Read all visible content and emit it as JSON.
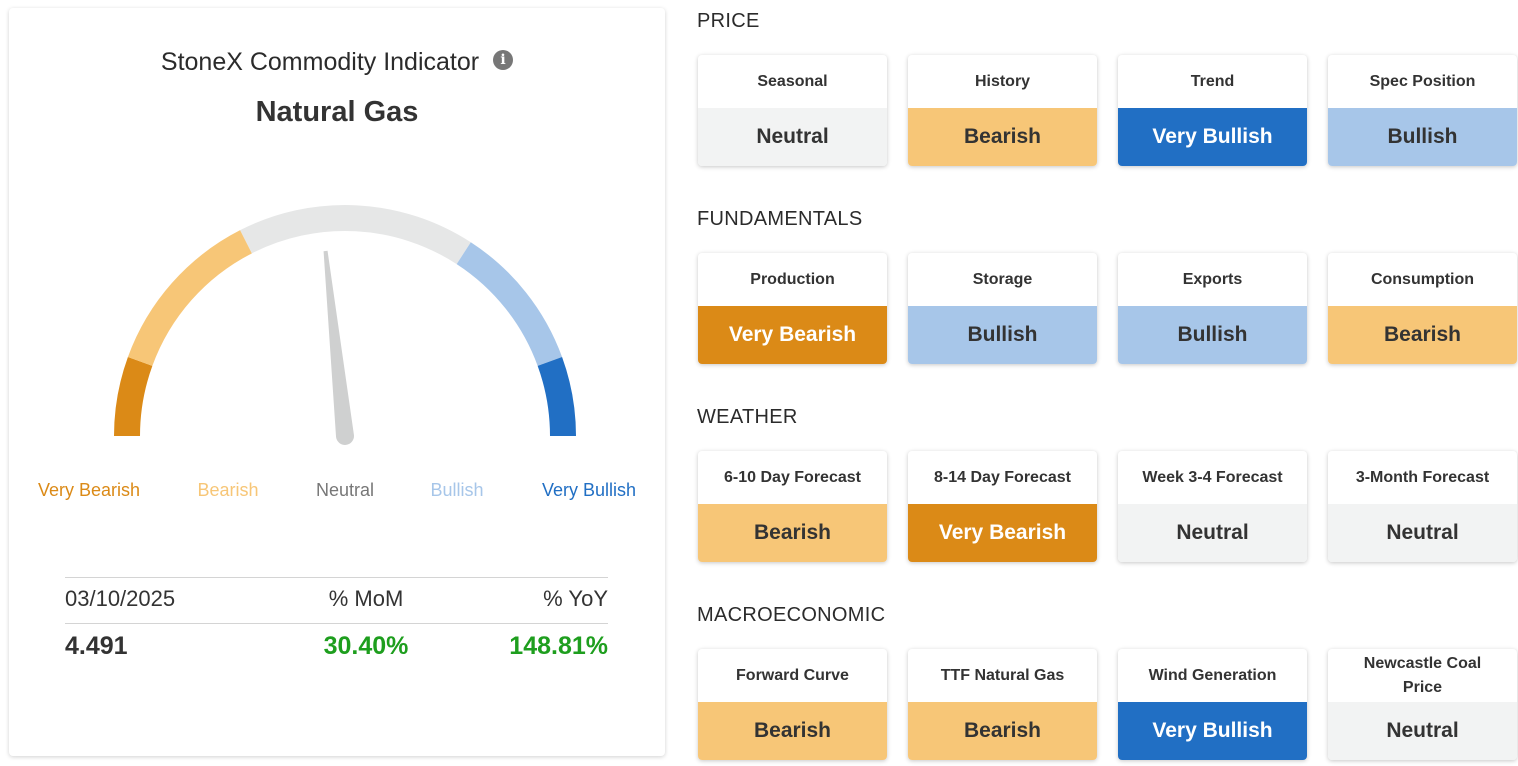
{
  "indicator": {
    "title": "StoneX Commodity Indicator",
    "info_icon": "info-icon",
    "commodity": "Natural Gas"
  },
  "gauge": {
    "reading": "Neutral",
    "labels": [
      "Very Bearish",
      "Bearish",
      "Neutral",
      "Bullish",
      "Very Bullish"
    ],
    "colors": {
      "very_bearish": "#db8a17",
      "bearish": "#f7c677",
      "neutral": "#e6e7e7",
      "bullish": "#a7c6e9",
      "very_bullish": "#216fc4",
      "needle": "#cfd0d0"
    }
  },
  "stats": {
    "date": "03/10/2025",
    "mom_label": "% MoM",
    "yoy_label": "% YoY",
    "price": "4.491",
    "mom": "30.40%",
    "yoy": "148.81%"
  },
  "sections": [
    {
      "title": "PRICE",
      "tiles": [
        {
          "label": "Seasonal",
          "value": "Neutral",
          "status": "neutral"
        },
        {
          "label": "History",
          "value": "Bearish",
          "status": "bearish"
        },
        {
          "label": "Trend",
          "value": "Very Bullish",
          "status": "very-bullish"
        },
        {
          "label": "Spec Position",
          "value": "Bullish",
          "status": "bullish"
        }
      ]
    },
    {
      "title": "FUNDAMENTALS",
      "tiles": [
        {
          "label": "Production",
          "value": "Very Bearish",
          "status": "very-bearish"
        },
        {
          "label": "Storage",
          "value": "Bullish",
          "status": "bullish"
        },
        {
          "label": "Exports",
          "value": "Bullish",
          "status": "bullish"
        },
        {
          "label": "Consumption",
          "value": "Bearish",
          "status": "bearish"
        }
      ]
    },
    {
      "title": "WEATHER",
      "tiles": [
        {
          "label": "6-10 Day Forecast",
          "value": "Bearish",
          "status": "bearish"
        },
        {
          "label": "8-14 Day Forecast",
          "value": "Very Bearish",
          "status": "very-bearish"
        },
        {
          "label": "Week 3-4 Forecast",
          "value": "Neutral",
          "status": "neutral"
        },
        {
          "label": "3-Month Forecast",
          "value": "Neutral",
          "status": "neutral"
        }
      ]
    },
    {
      "title": "MACROECONOMIC",
      "tiles": [
        {
          "label": "Forward Curve",
          "value": "Bearish",
          "status": "bearish"
        },
        {
          "label": "TTF Natural Gas",
          "value": "Bearish",
          "status": "bearish"
        },
        {
          "label": "Wind Generation",
          "value": "Very Bullish",
          "status": "very-bullish"
        },
        {
          "label": "Newcastle Coal Price",
          "value": "Neutral",
          "status": "neutral"
        }
      ]
    }
  ]
}
